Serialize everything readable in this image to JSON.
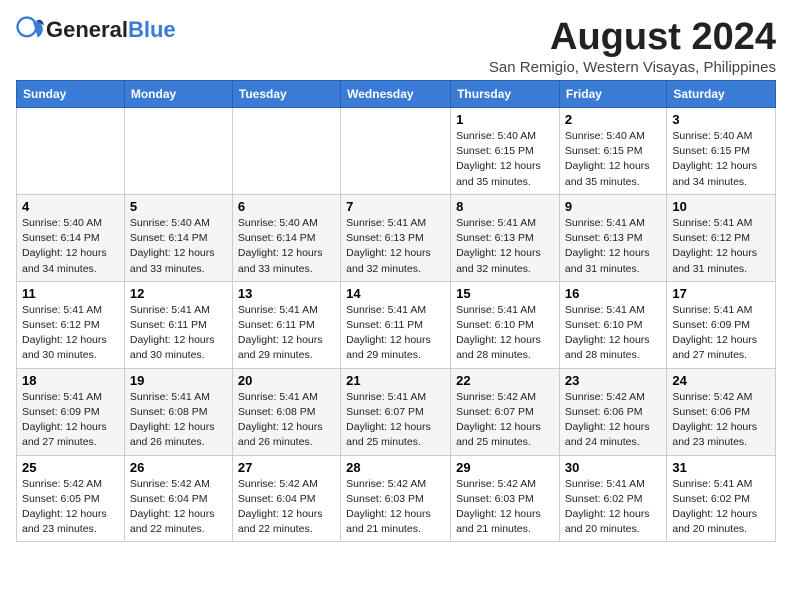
{
  "header": {
    "logo_general": "General",
    "logo_blue": "Blue",
    "title": "August 2024",
    "subtitle": "San Remigio, Western Visayas, Philippines"
  },
  "weekdays": [
    "Sunday",
    "Monday",
    "Tuesday",
    "Wednesday",
    "Thursday",
    "Friday",
    "Saturday"
  ],
  "weeks": [
    [
      {
        "num": "",
        "info": ""
      },
      {
        "num": "",
        "info": ""
      },
      {
        "num": "",
        "info": ""
      },
      {
        "num": "",
        "info": ""
      },
      {
        "num": "1",
        "info": "Sunrise: 5:40 AM\nSunset: 6:15 PM\nDaylight: 12 hours\nand 35 minutes."
      },
      {
        "num": "2",
        "info": "Sunrise: 5:40 AM\nSunset: 6:15 PM\nDaylight: 12 hours\nand 35 minutes."
      },
      {
        "num": "3",
        "info": "Sunrise: 5:40 AM\nSunset: 6:15 PM\nDaylight: 12 hours\nand 34 minutes."
      }
    ],
    [
      {
        "num": "4",
        "info": "Sunrise: 5:40 AM\nSunset: 6:14 PM\nDaylight: 12 hours\nand 34 minutes."
      },
      {
        "num": "5",
        "info": "Sunrise: 5:40 AM\nSunset: 6:14 PM\nDaylight: 12 hours\nand 33 minutes."
      },
      {
        "num": "6",
        "info": "Sunrise: 5:40 AM\nSunset: 6:14 PM\nDaylight: 12 hours\nand 33 minutes."
      },
      {
        "num": "7",
        "info": "Sunrise: 5:41 AM\nSunset: 6:13 PM\nDaylight: 12 hours\nand 32 minutes."
      },
      {
        "num": "8",
        "info": "Sunrise: 5:41 AM\nSunset: 6:13 PM\nDaylight: 12 hours\nand 32 minutes."
      },
      {
        "num": "9",
        "info": "Sunrise: 5:41 AM\nSunset: 6:13 PM\nDaylight: 12 hours\nand 31 minutes."
      },
      {
        "num": "10",
        "info": "Sunrise: 5:41 AM\nSunset: 6:12 PM\nDaylight: 12 hours\nand 31 minutes."
      }
    ],
    [
      {
        "num": "11",
        "info": "Sunrise: 5:41 AM\nSunset: 6:12 PM\nDaylight: 12 hours\nand 30 minutes."
      },
      {
        "num": "12",
        "info": "Sunrise: 5:41 AM\nSunset: 6:11 PM\nDaylight: 12 hours\nand 30 minutes."
      },
      {
        "num": "13",
        "info": "Sunrise: 5:41 AM\nSunset: 6:11 PM\nDaylight: 12 hours\nand 29 minutes."
      },
      {
        "num": "14",
        "info": "Sunrise: 5:41 AM\nSunset: 6:11 PM\nDaylight: 12 hours\nand 29 minutes."
      },
      {
        "num": "15",
        "info": "Sunrise: 5:41 AM\nSunset: 6:10 PM\nDaylight: 12 hours\nand 28 minutes."
      },
      {
        "num": "16",
        "info": "Sunrise: 5:41 AM\nSunset: 6:10 PM\nDaylight: 12 hours\nand 28 minutes."
      },
      {
        "num": "17",
        "info": "Sunrise: 5:41 AM\nSunset: 6:09 PM\nDaylight: 12 hours\nand 27 minutes."
      }
    ],
    [
      {
        "num": "18",
        "info": "Sunrise: 5:41 AM\nSunset: 6:09 PM\nDaylight: 12 hours\nand 27 minutes."
      },
      {
        "num": "19",
        "info": "Sunrise: 5:41 AM\nSunset: 6:08 PM\nDaylight: 12 hours\nand 26 minutes."
      },
      {
        "num": "20",
        "info": "Sunrise: 5:41 AM\nSunset: 6:08 PM\nDaylight: 12 hours\nand 26 minutes."
      },
      {
        "num": "21",
        "info": "Sunrise: 5:41 AM\nSunset: 6:07 PM\nDaylight: 12 hours\nand 25 minutes."
      },
      {
        "num": "22",
        "info": "Sunrise: 5:42 AM\nSunset: 6:07 PM\nDaylight: 12 hours\nand 25 minutes."
      },
      {
        "num": "23",
        "info": "Sunrise: 5:42 AM\nSunset: 6:06 PM\nDaylight: 12 hours\nand 24 minutes."
      },
      {
        "num": "24",
        "info": "Sunrise: 5:42 AM\nSunset: 6:06 PM\nDaylight: 12 hours\nand 23 minutes."
      }
    ],
    [
      {
        "num": "25",
        "info": "Sunrise: 5:42 AM\nSunset: 6:05 PM\nDaylight: 12 hours\nand 23 minutes."
      },
      {
        "num": "26",
        "info": "Sunrise: 5:42 AM\nSunset: 6:04 PM\nDaylight: 12 hours\nand 22 minutes."
      },
      {
        "num": "27",
        "info": "Sunrise: 5:42 AM\nSunset: 6:04 PM\nDaylight: 12 hours\nand 22 minutes."
      },
      {
        "num": "28",
        "info": "Sunrise: 5:42 AM\nSunset: 6:03 PM\nDaylight: 12 hours\nand 21 minutes."
      },
      {
        "num": "29",
        "info": "Sunrise: 5:42 AM\nSunset: 6:03 PM\nDaylight: 12 hours\nand 21 minutes."
      },
      {
        "num": "30",
        "info": "Sunrise: 5:41 AM\nSunset: 6:02 PM\nDaylight: 12 hours\nand 20 minutes."
      },
      {
        "num": "31",
        "info": "Sunrise: 5:41 AM\nSunset: 6:02 PM\nDaylight: 12 hours\nand 20 minutes."
      }
    ]
  ]
}
